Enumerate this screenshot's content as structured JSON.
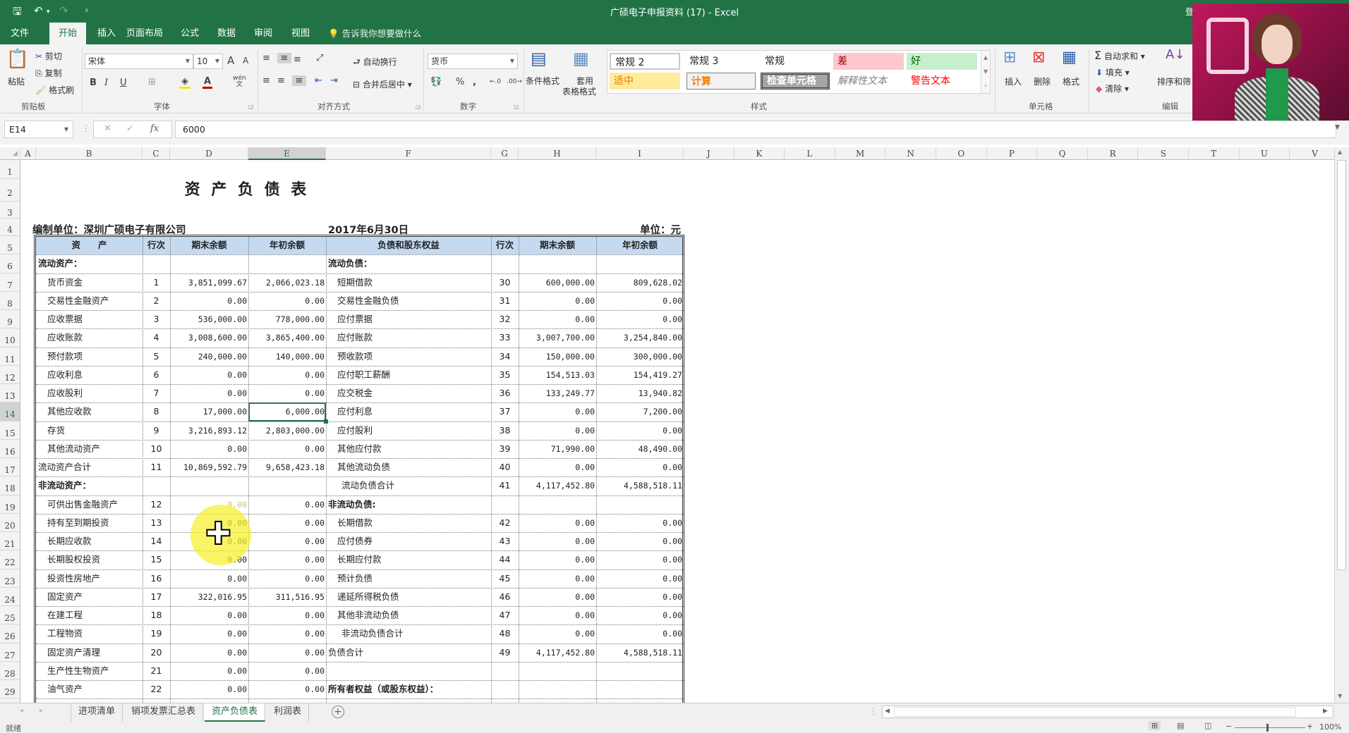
{
  "window": {
    "title": "广硕电子申报资料 (17)  -  Excel",
    "side_char": "登"
  },
  "quick_access": {
    "save_icon": "save-icon",
    "undo_icon": "undo-icon",
    "redo_icon": "redo-icon",
    "customize_icon": "customize-icon"
  },
  "ribbon_tabs": [
    {
      "label": "文件"
    },
    {
      "label": "开始",
      "active": true
    },
    {
      "label": "插入"
    },
    {
      "label": "页面布局"
    },
    {
      "label": "公式"
    },
    {
      "label": "数据"
    },
    {
      "label": "审阅"
    },
    {
      "label": "视图"
    }
  ],
  "tell_me": "告诉我你想要做什么",
  "ribbon": {
    "clipboard": {
      "paste": "粘贴",
      "cut": "剪切",
      "copy": "复制",
      "format_painter": "格式刷",
      "label": "剪贴板"
    },
    "font": {
      "name": "宋体",
      "size": "10",
      "bold": "B",
      "italic": "I",
      "underline": "U",
      "grow": "A",
      "shrink": "A",
      "label": "字体",
      "phonetic": "wén"
    },
    "alignment": {
      "wrap": "自动换行",
      "merge": "合并后居中",
      "label": "对齐方式"
    },
    "number": {
      "format": "货币",
      "percent": "%",
      "comma": ",",
      "inc_decimal": ".00→.0",
      "label": "数字"
    },
    "styles": {
      "conditional": "条件格式",
      "table_format_1": "套用",
      "table_format_2": "表格格式",
      "cells": [
        {
          "label": "常规 2",
          "bg": "#ffffff",
          "color": "#222222"
        },
        {
          "label": "常规 3",
          "bg": "#ffffff",
          "color": "#222222"
        },
        {
          "label": "常规",
          "bg": "#ffffff",
          "color": "#222222"
        },
        {
          "label": "差",
          "bg": "#ffc7ce",
          "color": "#9c0006"
        },
        {
          "label": "好",
          "bg": "#c6efce",
          "color": "#006100"
        },
        {
          "label": "适中",
          "bg": "#ffeb9c",
          "color": "#9c6500"
        },
        {
          "label": "计算",
          "bg": "#f2f2f2",
          "color": "#fa7d00"
        },
        {
          "label": "检查单元格",
          "bg": "#a5a5a5",
          "color": "#ffffff"
        },
        {
          "label": "解释性文本",
          "bg": "#ffffff",
          "color": "#7f7f7f"
        },
        {
          "label": "警告文本",
          "bg": "#ffffff",
          "color": "#ff0000"
        }
      ],
      "label": "样式"
    },
    "cells": {
      "insert": "插入",
      "delete": "删除",
      "format": "格式",
      "label": "单元格"
    },
    "editing": {
      "autosum": "自动求和",
      "fill": "填充",
      "clear": "清除",
      "sort_filter": "排序和筛",
      "label": "编辑"
    }
  },
  "formula_bar": {
    "name_box": "E14",
    "cancel": "✕",
    "enter": "✓",
    "fx": "fx",
    "value": "6000"
  },
  "columns": [
    "A",
    "B",
    "C",
    "D",
    "E",
    "F",
    "G",
    "H",
    "I",
    "J",
    "K",
    "L",
    "M",
    "N",
    "O",
    "P",
    "Q",
    "R",
    "S",
    "T",
    "U",
    "V"
  ],
  "selected_column": "E",
  "rows": [
    "1",
    "2",
    "3",
    "4",
    "5",
    "6",
    "7",
    "8",
    "9",
    "10",
    "11",
    "12",
    "13",
    "14",
    "15",
    "16",
    "17",
    "18",
    "19",
    "20",
    "21",
    "22",
    "23",
    "24",
    "25",
    "26",
    "27",
    "28",
    "29"
  ],
  "selected_row": "14",
  "sheet": {
    "title": "资 产 负 债 表",
    "company": "编制单位：深圳广硕电子有限公司",
    "date": "2017年6月30日",
    "unit": "单位：元",
    "headers": [
      "资　　产",
      "行次",
      "期末余额",
      "年初余额",
      "负债和股东权益",
      "行次",
      "期末余额",
      "年初余额"
    ],
    "rows": [
      {
        "a": "流动资产：",
        "a_bold": true,
        "b": "",
        "c": "",
        "d": "",
        "e": "流动负债：",
        "e_bold": true,
        "f": "",
        "g": "",
        "h": ""
      },
      {
        "a": "货币资金",
        "b": "1",
        "c": "3,851,099.67",
        "d": "2,066,023.18",
        "e": "短期借款",
        "f": "30",
        "g": "600,000.00",
        "h": "809,628.02"
      },
      {
        "a": "交易性金融资产",
        "b": "2",
        "c": "0.00",
        "d": "0.00",
        "e": "交易性金融负债",
        "f": "31",
        "g": "0.00",
        "h": "0.00"
      },
      {
        "a": "应收票据",
        "b": "3",
        "c": "536,000.00",
        "d": "778,000.00",
        "e": "应付票据",
        "f": "32",
        "g": "0.00",
        "h": "0.00"
      },
      {
        "a": "应收账款",
        "b": "4",
        "c": "3,008,600.00",
        "d": "3,865,400.00",
        "e": "应付账款",
        "f": "33",
        "g": "3,007,700.00",
        "h": "3,254,840.00"
      },
      {
        "a": "预付款项",
        "b": "5",
        "c": "240,000.00",
        "d": "140,000.00",
        "e": "预收款项",
        "f": "34",
        "g": "150,000.00",
        "h": "300,000.00"
      },
      {
        "a": "应收利息",
        "b": "6",
        "c": "0.00",
        "d": "0.00",
        "e": "应付职工薪酬",
        "f": "35",
        "g": "154,513.03",
        "h": "154,419.27"
      },
      {
        "a": "应收股利",
        "b": "7",
        "c": "0.00",
        "d": "0.00",
        "e": "应交税金",
        "f": "36",
        "g": "133,249.77",
        "h": "13,940.82"
      },
      {
        "a": "其他应收款",
        "b": "8",
        "c": "17,000.00",
        "d": "6,000.00",
        "e": "应付利息",
        "f": "37",
        "g": "0.00",
        "h": "7,200.00"
      },
      {
        "a": "存货",
        "b": "9",
        "c": "3,216,893.12",
        "d": "2,803,000.00",
        "e": "应付股利",
        "f": "38",
        "g": "0.00",
        "h": "0.00"
      },
      {
        "a": "其他流动资产",
        "b": "10",
        "c": "0.00",
        "d": "0.00",
        "e": "其他应付款",
        "f": "39",
        "g": "71,990.00",
        "h": "48,490.00"
      },
      {
        "a": "流动资产合计",
        "a_flush": true,
        "b": "11",
        "c": "10,869,592.79",
        "d": "9,658,423.18",
        "e": "其他流动负债",
        "f": "40",
        "g": "0.00",
        "h": "0.00"
      },
      {
        "a": "非流动资产：",
        "a_bold": true,
        "b": "",
        "c": "",
        "d": "",
        "e": "流动负债合计",
        "e_sub": true,
        "f": "41",
        "g": "4,117,452.80",
        "h": "4,588,518.11"
      },
      {
        "a": "可供出售金融资产",
        "b": "12",
        "c": "0.00",
        "d": "0.00",
        "e": "非流动负债:",
        "e_bold": true,
        "f": "",
        "g": "",
        "h": ""
      },
      {
        "a": "持有至到期投资",
        "b": "13",
        "c": "0.00",
        "d": "0.00",
        "e": "长期借款",
        "f": "42",
        "g": "0.00",
        "h": "0.00"
      },
      {
        "a": "长期应收款",
        "b": "14",
        "c": "0.00",
        "d": "0.00",
        "e": "应付债券",
        "f": "43",
        "g": "0.00",
        "h": "0.00"
      },
      {
        "a": "长期股权投资",
        "b": "15",
        "c": "0.00",
        "d": "0.00",
        "e": "长期应付款",
        "f": "44",
        "g": "0.00",
        "h": "0.00"
      },
      {
        "a": "投资性房地产",
        "b": "16",
        "c": "0.00",
        "d": "0.00",
        "e": "预计负债",
        "f": "45",
        "g": "0.00",
        "h": "0.00"
      },
      {
        "a": "固定资产",
        "b": "17",
        "c": "322,016.95",
        "d": "311,516.95",
        "e": "递延所得税负债",
        "f": "46",
        "g": "0.00",
        "h": "0.00"
      },
      {
        "a": "在建工程",
        "b": "18",
        "c": "0.00",
        "d": "0.00",
        "e": "其他非流动负债",
        "f": "47",
        "g": "0.00",
        "h": "0.00"
      },
      {
        "a": "工程物资",
        "b": "19",
        "c": "0.00",
        "d": "0.00",
        "e": "非流动负债合计",
        "e_sub": true,
        "f": "48",
        "g": "0.00",
        "h": "0.00"
      },
      {
        "a": "固定资产清理",
        "b": "20",
        "c": "0.00",
        "d": "0.00",
        "e": "负债合计",
        "e_flush": true,
        "f": "49",
        "g": "4,117,452.80",
        "h": "4,588,518.11"
      },
      {
        "a": "生产性生物资产",
        "b": "21",
        "c": "0.00",
        "d": "0.00",
        "e": "",
        "f": "",
        "g": "",
        "h": ""
      },
      {
        "a": "油气资产",
        "b": "22",
        "c": "0.00",
        "d": "0.00",
        "e": "所有者权益（或股东权益）：",
        "e_bold": true,
        "f": "",
        "g": "",
        "h": ""
      }
    ]
  },
  "sheet_tabs": [
    {
      "label": "进项清单"
    },
    {
      "label": "销项发票汇总表"
    },
    {
      "label": "资产负债表",
      "active": true
    },
    {
      "label": "利润表"
    }
  ],
  "add_sheet": "+",
  "status": {
    "ready": "就绪",
    "zoom": "100%"
  },
  "colors": {
    "excel_green": "#217346",
    "header_blue": "#c5d9f1",
    "cursor_highlight": "#f5f032"
  }
}
